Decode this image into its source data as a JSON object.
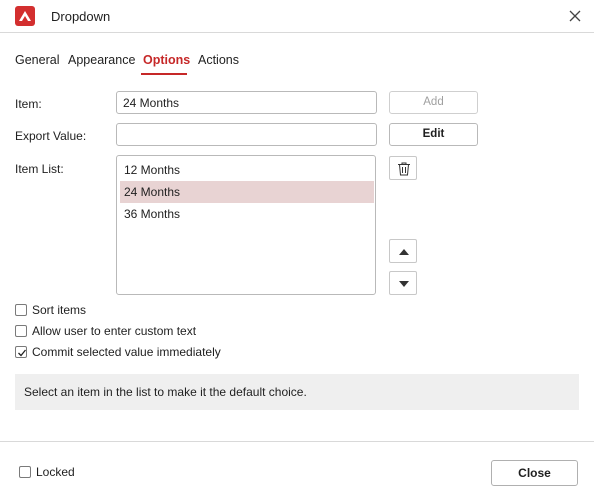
{
  "window": {
    "title": "Dropdown"
  },
  "icons": {
    "app": "app-logo-icon",
    "close": "close-icon",
    "delete": "trash-icon",
    "up": "arrow-up-icon",
    "down": "arrow-down-icon",
    "check": "checkmark-icon"
  },
  "colors": {
    "accent": "#c62828",
    "selected_row": "#e8d3d3",
    "hint_bg": "#efefef"
  },
  "tabs": [
    {
      "label": "General"
    },
    {
      "label": "Appearance"
    },
    {
      "label": "Options"
    },
    {
      "label": "Actions"
    }
  ],
  "active_tab": "Options",
  "form": {
    "item_label": "Item:",
    "item_value": "24 Months",
    "add_label": "Add",
    "export_label": "Export Value:",
    "export_value": "",
    "edit_label": "Edit",
    "item_list_label": "Item List:"
  },
  "item_list": [
    "12 Months",
    "24 Months",
    "36 Months"
  ],
  "selected_item": "24 Months",
  "options": [
    {
      "label": "Sort items",
      "checked": false
    },
    {
      "label": "Allow user to enter custom text",
      "checked": false
    },
    {
      "label": "Commit selected value immediately",
      "checked": true
    }
  ],
  "hint": "Select an item in the list to make it the default choice.",
  "footer": {
    "locked_label": "Locked",
    "locked_checked": false,
    "close_label": "Close"
  }
}
